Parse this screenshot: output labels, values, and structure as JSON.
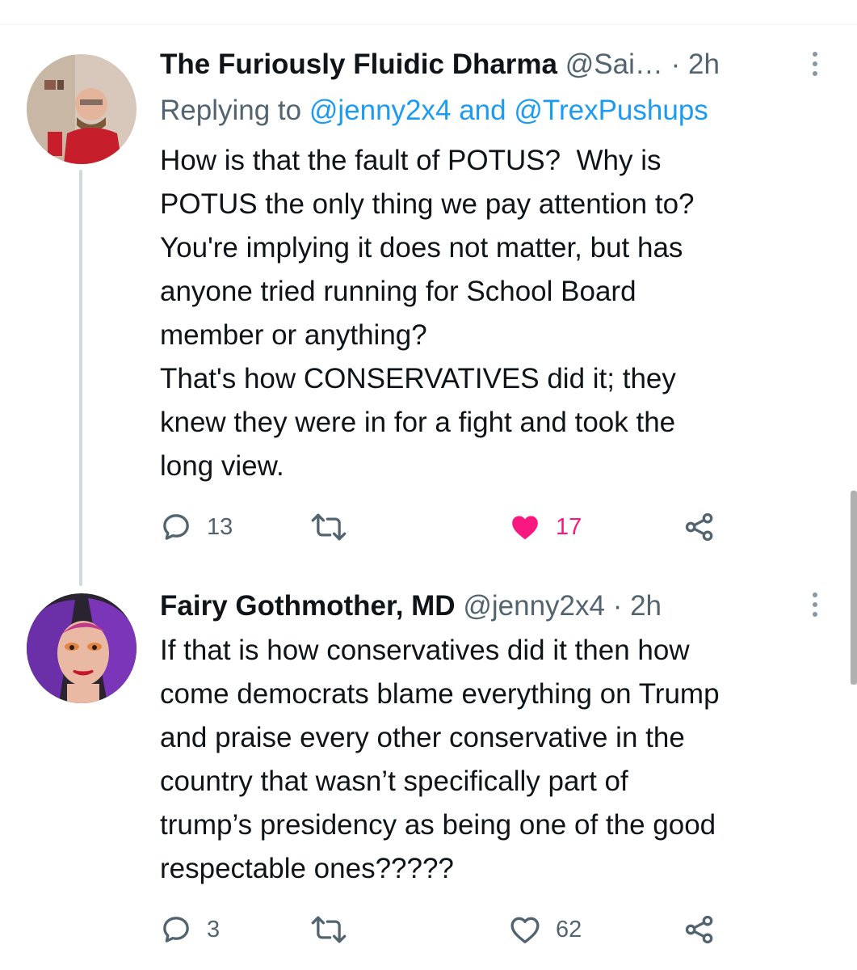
{
  "tweets": [
    {
      "display_name": "The Furiously Fluidic Dharma",
      "handle": "@Sai…",
      "separator": "·",
      "time": "2h",
      "replying_prefix": "Replying to",
      "replying_to_1": "@jenny2x4",
      "replying_and": "and",
      "replying_to_2": "@TrexPushups",
      "text": "How is that the fault of POTUS?  Why is\nPOTUS the only thing we pay attention to?\nYou're implying it does not matter, but has\nanyone tried running for School Board\nmember or anything?\nThat's how CONSERVATIVES did it; they\nknew they were in for a fight and took the\nlong view.",
      "reply_count": "13",
      "like_count": "17",
      "liked": true
    },
    {
      "display_name": "Fairy Gothmother, MD",
      "handle": "@jenny2x4",
      "separator": "·",
      "time": "2h",
      "text": "If that is how conservatives did it then how\ncome democrats blame everything on Trump\nand praise every other conservative in the\ncountry that wasn’t specifically part of\ntrump’s presidency as being one of the good\nrespectable ones?????",
      "reply_count": "3",
      "like_count": "62",
      "liked": false
    }
  ],
  "icons": {
    "more": "more-vertical-icon",
    "reply": "reply-bubble-icon",
    "retweet": "retweet-icon",
    "like": "heart-icon",
    "share": "share-icon"
  },
  "colors": {
    "link": "#1d9bf0",
    "secondary_text": "#536471",
    "liked": "#f91880",
    "thread_line": "#cfd9de"
  }
}
